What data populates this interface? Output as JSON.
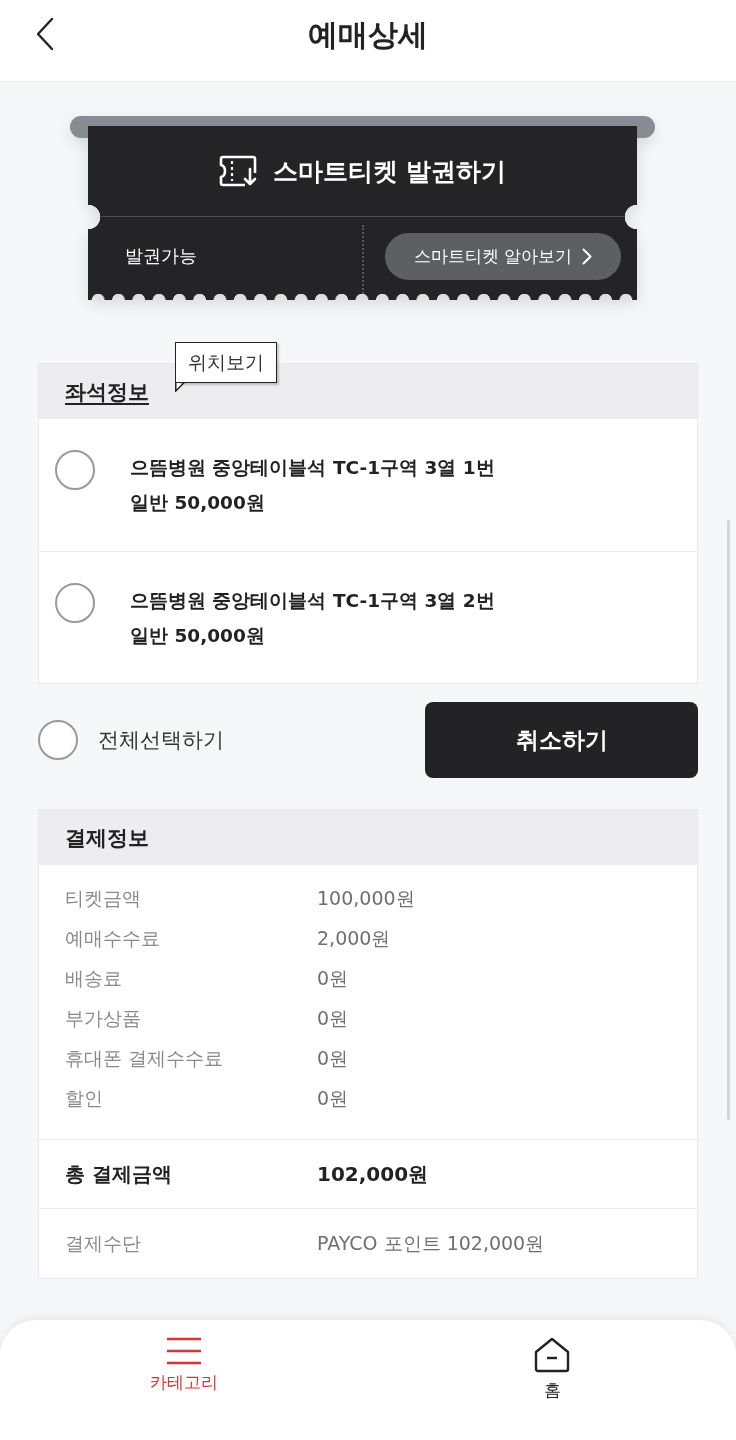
{
  "header": {
    "title": "예매상세"
  },
  "smart_ticket": {
    "title": "스마트티켓 발권하기",
    "status": "발권가능",
    "guide_button": "스마트티켓 알아보기"
  },
  "seat_info": {
    "title": "좌석정보",
    "tooltip": "위치보기",
    "seats": [
      {
        "name": "으뜸병원 중앙테이블석 TC-1구역 3열 1번",
        "price": "일반 50,000원",
        "selected": false
      },
      {
        "name": "으뜸병원 중앙테이블석 TC-1구역 3열 2번",
        "price": "일반 50,000원",
        "selected": false
      }
    ]
  },
  "select_all": {
    "label": "전체선택하기",
    "checked": false
  },
  "cancel_button": "취소하기",
  "payment": {
    "title": "결제정보",
    "items": [
      {
        "label": "티켓금액",
        "value": "100,000원"
      },
      {
        "label": "예매수수료",
        "value": "2,000원"
      },
      {
        "label": "배송료",
        "value": "0원"
      },
      {
        "label": "부가상품",
        "value": "0원"
      },
      {
        "label": "휴대폰 결제수수료",
        "value": "0원"
      },
      {
        "label": "할인",
        "value": "0원"
      }
    ],
    "total": {
      "label": "총 결제금액",
      "value": "102,000원"
    },
    "method": {
      "label": "결제수단",
      "value": "PAYCO 포인트 102,000원"
    }
  },
  "bottom_nav": [
    {
      "kind": "menu",
      "label": "카테고리",
      "selected": true
    },
    {
      "kind": "home",
      "label": "홈",
      "selected": false
    }
  ]
}
